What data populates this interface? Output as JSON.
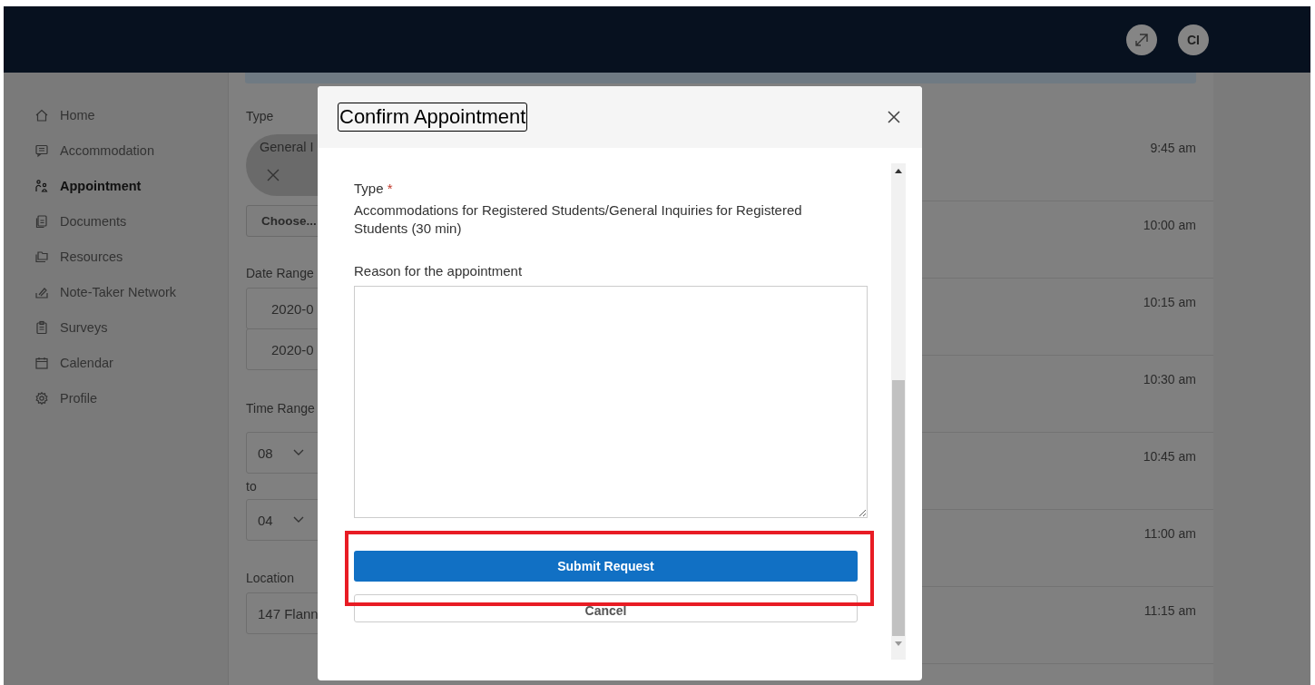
{
  "header": {
    "actions": [
      {
        "kind": "expand"
      },
      {
        "kind": "avatar",
        "label": "CI"
      }
    ]
  },
  "sidebar": {
    "items": [
      {
        "label": "Home",
        "selected": false
      },
      {
        "label": "Accommodation",
        "selected": false
      },
      {
        "label": "Appointment",
        "selected": true
      },
      {
        "label": "Documents",
        "selected": false
      },
      {
        "label": "Resources",
        "selected": false
      },
      {
        "label": "Note-Taker Network",
        "selected": false
      },
      {
        "label": "Surveys",
        "selected": false
      },
      {
        "label": "Calendar",
        "selected": false
      },
      {
        "label": "Profile",
        "selected": false
      }
    ]
  },
  "form": {
    "type_label": "Type",
    "type_chip": "General I",
    "choose_button": "Choose...",
    "date_label": "Date Range",
    "dates": [
      "2020-0",
      "2020-0"
    ],
    "time_label": "Time Range",
    "time_from": "08",
    "time_separator": "to",
    "time_to": "04",
    "location_label": "Location",
    "location_value": "147 Flann"
  },
  "times": [
    "9:45 am",
    "10:00 am",
    "10:15 am",
    "10:30 am",
    "10:45 am",
    "11:00 am",
    "11:15 am"
  ],
  "dialog": {
    "title": "Confirm Appointment",
    "type_label": "Type",
    "type_required_mark": "*",
    "type_value": "Accommodations for Registered Students/General Inquiries for Registered Students (30 min)",
    "reason_label": "Reason for the appointment",
    "submit_button": "Submit Request",
    "cancel_button": "Cancel",
    "highlight_submit": true
  }
}
